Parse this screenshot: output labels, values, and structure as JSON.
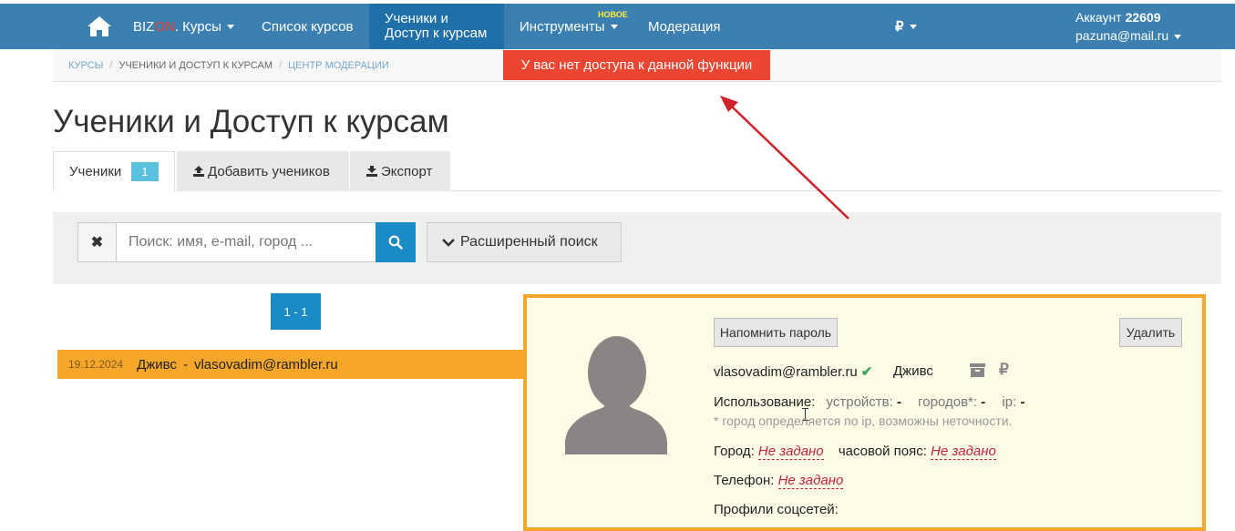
{
  "nav": {
    "brand_prefix": "BIZ",
    "brand_on": "ON",
    "brand_suffix": ". Курсы",
    "courses_list": "Список курсов",
    "students_line1": "Ученики и",
    "students_line2": "Доступ к курсам",
    "tools": "Инструменты",
    "tools_badge": "НОВОЕ",
    "moderation": "Модерация",
    "currency": "₽",
    "account_label": "Аккаунт",
    "account_id": "22609",
    "account_email": "pazuna@mail.ru"
  },
  "breadcrumb": {
    "items": [
      "КУРСЫ",
      "УЧЕНИКИ И ДОСТУП К КУРСАМ",
      "ЦЕНТР МОДЕРАЦИИ"
    ],
    "separator": "/"
  },
  "alert": "У вас нет доступа к данной функции",
  "page_title": "Ученики и Доступ к курсам",
  "tabs": {
    "students_label": "Ученики",
    "students_count": "1",
    "add_label": "Добавить учеников",
    "export_label": "Экспорт"
  },
  "search": {
    "placeholder": "Поиск: имя, e-mail, город ...",
    "advanced_label": "Расширенный поиск"
  },
  "pager": "1 - 1",
  "student_row": {
    "date": "19.12.2024",
    "name": "Дживс",
    "dash": "-",
    "email": "vlasovadim@rambler.ru"
  },
  "details": {
    "remind_button": "Напомнить пароль",
    "delete_button": "Удалить",
    "email": "vlasovadim@rambler.ru",
    "check": "✔",
    "name": "Дживс",
    "currency": "₽",
    "usage_label": "Использование:",
    "devices_label": "устройств:",
    "devices_value": "-",
    "cities_label": "городов*:",
    "cities_value": "-",
    "ip_label": "ip:",
    "ip_value": "-",
    "note": "* город определяется по ip, возможны неточности.",
    "city_label": "Город:",
    "city_value": "Не задано",
    "timezone_label": "часовой пояс:",
    "timezone_value": "Не задано",
    "phone_label": "Телефон:",
    "phone_value": "Не задано",
    "social_label": "Профили соцсетей:"
  },
  "colors": {
    "navbar": "#3b80b1",
    "navbar_active": "#1f6fa8",
    "alert": "#ec4532",
    "accent_orange": "#f6a72a",
    "primary_button": "#1a8bc5",
    "annotation_arrow": "#d0202a"
  },
  "icons": {
    "home": "home-icon",
    "clear": "close-icon",
    "search": "search-icon",
    "advanced": "chevron-down-icon",
    "upload": "upload-icon",
    "download": "download-icon",
    "archive": "archive-icon"
  }
}
